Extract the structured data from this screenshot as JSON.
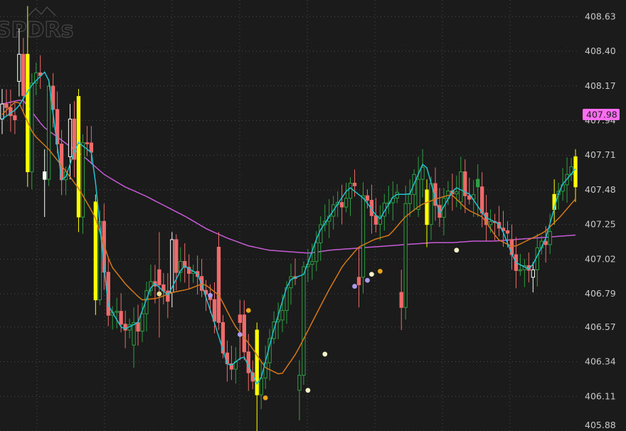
{
  "logo": {
    "text": "SPDRs"
  },
  "last_price": {
    "value": 407.98,
    "label": "407.98"
  },
  "colors": {
    "background": "#1b1b1b",
    "grid": "#4a4a4a",
    "bull_candle": "#2ea043",
    "bear_candle": "#ef6b6b",
    "highlight_candle": "#ffff00",
    "white_candle": "#ffffff",
    "fast_ma": "#22c3cf",
    "slow_ma": "#d4781a",
    "long_ma": "#c65bd6",
    "last_price_tag": "#ff6df2"
  },
  "chart_data": {
    "type": "candlestick",
    "title": "",
    "xlabel": "",
    "ylabel": "",
    "ylim": [
      405.88,
      408.74
    ],
    "y_ticks": [
      408.63,
      408.4,
      408.17,
      407.94,
      407.71,
      407.48,
      407.25,
      407.02,
      406.79,
      406.57,
      406.34,
      406.11,
      405.88
    ],
    "grid": true,
    "legend": "none",
    "candle_count": 136,
    "key_candles": [
      {
        "idx": 0,
        "open": 407.95,
        "high": 408.15,
        "low": 407.85,
        "close": 408.05,
        "color": "white"
      },
      {
        "idx": 4,
        "open": 408.2,
        "high": 408.55,
        "low": 408.1,
        "close": 408.38,
        "color": "white"
      },
      {
        "idx": 6,
        "open": 408.38,
        "high": 408.7,
        "low": 407.5,
        "close": 407.6,
        "color": "yellow"
      },
      {
        "idx": 10,
        "open": 407.6,
        "high": 407.75,
        "low": 407.3,
        "close": 407.55,
        "color": "white"
      },
      {
        "idx": 16,
        "open": 407.7,
        "high": 408.05,
        "low": 407.55,
        "close": 407.95,
        "color": "white"
      },
      {
        "idx": 18,
        "open": 408.1,
        "high": 408.15,
        "low": 407.2,
        "close": 407.3,
        "color": "yellow"
      },
      {
        "idx": 22,
        "open": 407.4,
        "high": 407.45,
        "low": 406.65,
        "close": 406.75,
        "color": "yellow"
      },
      {
        "idx": 31,
        "open": 406.45,
        "high": 406.7,
        "low": 406.3,
        "close": 406.6,
        "color": "green"
      },
      {
        "idx": 37,
        "open": 406.95,
        "high": 407.2,
        "low": 406.5,
        "close": 406.85,
        "color": "red"
      },
      {
        "idx": 40,
        "open": 406.8,
        "high": 407.2,
        "low": 406.7,
        "close": 407.15,
        "color": "white"
      },
      {
        "idx": 51,
        "open": 407.1,
        "high": 407.2,
        "low": 406.55,
        "close": 406.6,
        "color": "red"
      },
      {
        "idx": 56,
        "open": 406.6,
        "high": 406.75,
        "low": 406.35,
        "close": 406.65,
        "color": "red"
      },
      {
        "idx": 60,
        "open": 406.55,
        "high": 406.6,
        "low": 405.88,
        "close": 406.12,
        "color": "yellow"
      },
      {
        "idx": 70,
        "open": 406.15,
        "high": 406.35,
        "low": 405.95,
        "close": 406.25,
        "color": "green"
      },
      {
        "idx": 84,
        "open": 406.85,
        "high": 407.1,
        "low": 406.7,
        "close": 406.9,
        "color": "red"
      },
      {
        "idx": 94,
        "open": 406.8,
        "high": 406.95,
        "low": 406.55,
        "close": 406.7,
        "color": "red"
      },
      {
        "idx": 98,
        "open": 407.35,
        "high": 407.7,
        "low": 407.3,
        "close": 407.55,
        "color": "green"
      },
      {
        "idx": 100,
        "open": 407.48,
        "high": 407.55,
        "low": 407.1,
        "close": 407.25,
        "color": "yellow"
      },
      {
        "idx": 108,
        "open": 407.4,
        "high": 407.7,
        "low": 407.35,
        "close": 407.6,
        "color": "green"
      },
      {
        "idx": 112,
        "open": 407.55,
        "high": 407.65,
        "low": 407.3,
        "close": 407.5,
        "color": "green"
      },
      {
        "idx": 120,
        "open": 407.15,
        "high": 407.25,
        "low": 406.95,
        "close": 407.05,
        "color": "red"
      },
      {
        "idx": 125,
        "open": 406.9,
        "high": 407.0,
        "low": 406.8,
        "close": 406.95,
        "color": "white"
      },
      {
        "idx": 130,
        "open": 407.35,
        "high": 407.55,
        "low": 407.25,
        "close": 407.45,
        "color": "yellow"
      },
      {
        "idx": 135,
        "open": 407.5,
        "high": 407.75,
        "low": 407.4,
        "close": 407.7,
        "color": "yellow"
      }
    ],
    "series": [
      {
        "values": [
          407.95,
          408.02,
          408.18,
          408.28,
          407.5,
          407.8,
          407.72,
          406.72,
          406.55,
          406.6,
          406.87,
          406.78,
          406.98,
          406.92,
          406.62,
          406.3,
          406.38,
          406.17,
          406.55,
          406.88,
          406.92,
          407.2,
          407.35,
          407.5,
          407.42,
          407.28,
          407.45,
          407.45,
          407.68,
          407.32,
          407.5,
          407.45,
          407.3,
          407.25,
          407.0,
          406.95,
          407.15,
          407.5,
          407.62
        ]
      },
      {
        "values": [
          407.98,
          408.08,
          407.85,
          407.75,
          407.62,
          407.48,
          407.3,
          406.98,
          406.85,
          406.75,
          406.76,
          406.8,
          406.82,
          406.86,
          406.78,
          406.58,
          406.45,
          406.3,
          406.25,
          406.4,
          406.6,
          406.8,
          406.98,
          407.1,
          407.15,
          407.18,
          407.3,
          407.38,
          407.42,
          407.45,
          407.35,
          407.3,
          407.15,
          407.1,
          407.15,
          407.2,
          407.3,
          407.42
        ]
      },
      {
        "values": [
          408.05,
          408.08,
          407.9,
          407.8,
          407.7,
          407.58,
          407.5,
          407.44,
          407.37,
          407.3,
          407.22,
          407.16,
          407.11,
          407.08,
          407.07,
          407.06,
          407.08,
          407.09,
          407.1,
          407.11,
          407.12,
          407.13,
          407.13,
          407.14,
          407.14,
          407.15,
          407.16,
          407.17,
          407.18
        ]
      }
    ],
    "markers": [
      {
        "idx": 37,
        "value": 406.79,
        "color": "#f5d98a"
      },
      {
        "idx": 49,
        "value": 406.78,
        "color": "#a99cf0"
      },
      {
        "idx": 56,
        "value": 406.52,
        "color": "#a99cf0"
      },
      {
        "idx": 58,
        "value": 406.68,
        "color": "#e8a41a"
      },
      {
        "idx": 62,
        "value": 406.1,
        "color": "#e8a41a"
      },
      {
        "idx": 72,
        "value": 406.15,
        "color": "#f5f1c8"
      },
      {
        "idx": 76,
        "value": 406.39,
        "color": "#f5f1c8"
      },
      {
        "idx": 83,
        "value": 406.84,
        "color": "#a99cf0"
      },
      {
        "idx": 86,
        "value": 406.88,
        "color": "#a99cf0"
      },
      {
        "idx": 87,
        "value": 406.92,
        "color": "#f5f1c8"
      },
      {
        "idx": 89,
        "value": 406.94,
        "color": "#e8a41a"
      },
      {
        "idx": 107,
        "value": 407.08,
        "color": "#f5f1c8"
      }
    ]
  }
}
